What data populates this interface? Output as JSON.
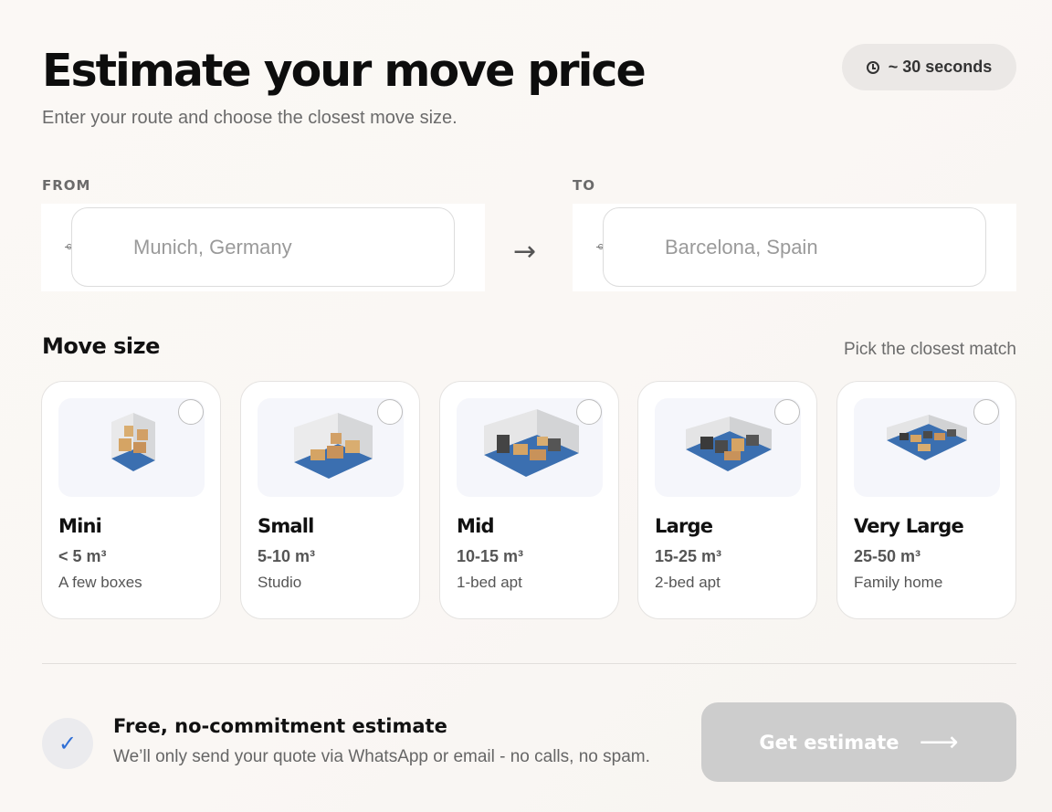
{
  "header": {
    "title": "Estimate your move price",
    "subtitle": "Enter your route and choose the closest move size.",
    "time_badge": "~ 30 seconds"
  },
  "route": {
    "from_label": "FROM",
    "from_placeholder": "Munich, Germany",
    "to_label": "TO",
    "to_placeholder": "Barcelona, Spain",
    "arrow": "→"
  },
  "move_size": {
    "title": "Move size",
    "hint": "Pick the closest match",
    "options": [
      {
        "name": "Mini",
        "volume": "< 5 m³",
        "description": "A few boxes"
      },
      {
        "name": "Small",
        "volume": "5-10 m³",
        "description": "Studio"
      },
      {
        "name": "Mid",
        "volume": "10-15 m³",
        "description": "1-bed apt"
      },
      {
        "name": "Large",
        "volume": "15-25 m³",
        "description": "2-bed apt"
      },
      {
        "name": "Very Large",
        "volume": "25-50 m³",
        "description": "Family home"
      }
    ]
  },
  "footer": {
    "check": "✓",
    "assurance_title": "Free, no-commitment estimate",
    "assurance_text": "We’ll only send your quote via WhatsApp or email - no calls, no spam.",
    "cta_label": "Get estimate",
    "cta_arrow": "⟶",
    "cta_color": "#cdcdcd"
  }
}
